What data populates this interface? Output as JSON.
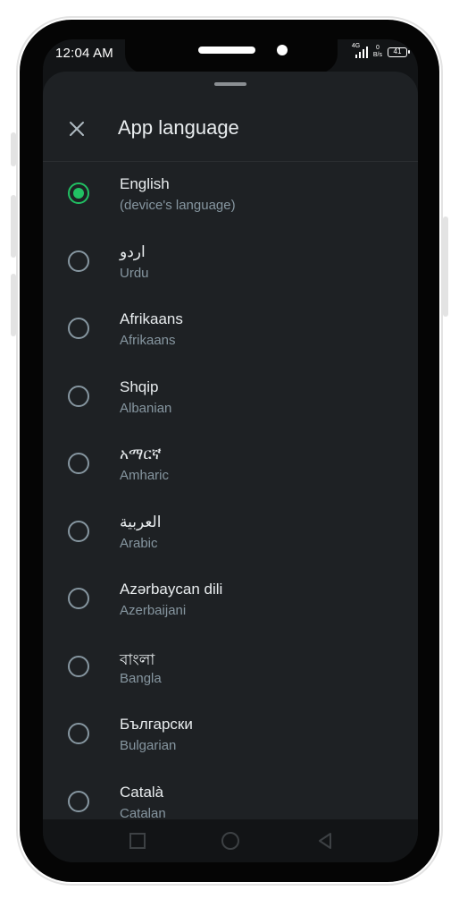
{
  "status_bar": {
    "time": "12:04 AM",
    "network": "4G",
    "speed_top": "0",
    "speed_bottom": "B/s",
    "battery": "41"
  },
  "sheet": {
    "title": "App language",
    "close_icon": "close-icon"
  },
  "languages": [
    {
      "native": "English",
      "sub": "(device's language)",
      "selected": true
    },
    {
      "native": "اردو",
      "sub": "Urdu",
      "selected": false
    },
    {
      "native": "Afrikaans",
      "sub": "Afrikaans",
      "selected": false
    },
    {
      "native": "Shqip",
      "sub": "Albanian",
      "selected": false
    },
    {
      "native": "አማርኛ",
      "sub": "Amharic",
      "selected": false
    },
    {
      "native": "العربية",
      "sub": "Arabic",
      "selected": false
    },
    {
      "native": "Azərbaycan dili",
      "sub": "Azerbaijani",
      "selected": false
    },
    {
      "native": "বাংলা",
      "sub": "Bangla",
      "selected": false
    },
    {
      "native": "Български",
      "sub": "Bulgarian",
      "selected": false
    },
    {
      "native": "Català",
      "sub": "Catalan",
      "selected": false
    }
  ],
  "nav_bar": {
    "icons": [
      "recents-square-icon",
      "home-circle-icon",
      "back-triangle-icon"
    ]
  },
  "colors": {
    "accent": "#21c063",
    "sheet_background": "#1e2124",
    "primary_text": "#e9edef",
    "secondary_text": "#8696a0"
  }
}
